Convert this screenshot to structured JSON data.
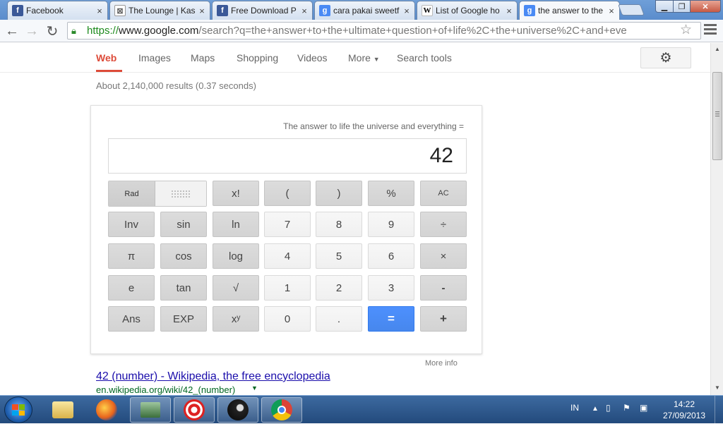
{
  "browser": {
    "tabs": [
      {
        "title": "Facebook",
        "favicon": "facebook-favicon"
      },
      {
        "title": "The Lounge | Kas",
        "favicon": "lounge-favicon"
      },
      {
        "title": "Free Download P",
        "favicon": "facebook-favicon"
      },
      {
        "title": "cara pakai sweetf",
        "favicon": "google-favicon"
      },
      {
        "title": "List of Google ho",
        "favicon": "wikipedia-favicon"
      },
      {
        "title": "the answer to the",
        "favicon": "google-favicon",
        "active": true
      }
    ],
    "url": {
      "scheme": "https://",
      "host": "www.google.com",
      "rest": "/search?q=the+answer+to+the+ultimate+question+of+life%2C+the+universe%2C+and+eve"
    }
  },
  "google_nav": {
    "tabs": [
      "Web",
      "Images",
      "Maps",
      "Shopping",
      "Videos",
      "More",
      "Search tools"
    ],
    "active": "Web"
  },
  "result_stats": "About 2,140,000 results (0.37 seconds)",
  "calculator": {
    "expression": "The answer to life the universe and everything =",
    "result": "42",
    "mode_left": "Rad",
    "keys": [
      [
        "x!",
        "(",
        ")",
        "%",
        "AC"
      ],
      [
        "Inv",
        "sin",
        "ln",
        "7",
        "8",
        "9",
        "÷"
      ],
      [
        "π",
        "cos",
        "log",
        "4",
        "5",
        "6",
        "×"
      ],
      [
        "e",
        "tan",
        "√",
        "1",
        "2",
        "3",
        "-"
      ],
      [
        "Ans",
        "EXP",
        "xʸ",
        "0",
        ".",
        "=",
        "+"
      ]
    ],
    "more_info": "More info"
  },
  "search_result": {
    "title": "42 (number) - Wikipedia, the free encyclopedia",
    "url": "en.wikipedia.org/wiki/42_(number)"
  },
  "taskbar": {
    "lang": "IN",
    "time": "14:22",
    "date": "27/09/2013"
  }
}
